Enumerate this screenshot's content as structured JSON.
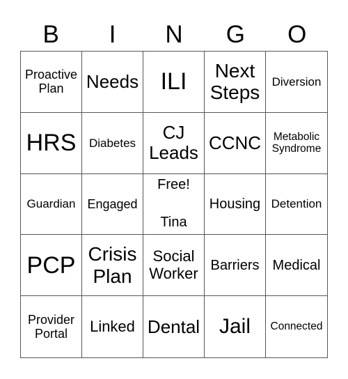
{
  "header": {
    "letters": [
      "B",
      "I",
      "N",
      "G",
      "O"
    ]
  },
  "board": {
    "cells": [
      [
        "Proactive Plan",
        "Needs",
        "ILI",
        "Next Steps",
        "Diversion"
      ],
      [
        "HRS",
        "Diabetes",
        "CJ Leads",
        "CCNC",
        "Metabolic Syndrome"
      ],
      [
        "Guardian",
        "Engaged",
        "Free!\n\nTina",
        "Housing",
        "Detention"
      ],
      [
        "PCP",
        "Crisis Plan",
        "Social Worker",
        "Barriers",
        "Medical"
      ],
      [
        "Provider Portal",
        "Linked",
        "Dental",
        "Jail",
        "Connected"
      ]
    ],
    "free_space": {
      "label": "Free!",
      "name": "Tina"
    }
  }
}
